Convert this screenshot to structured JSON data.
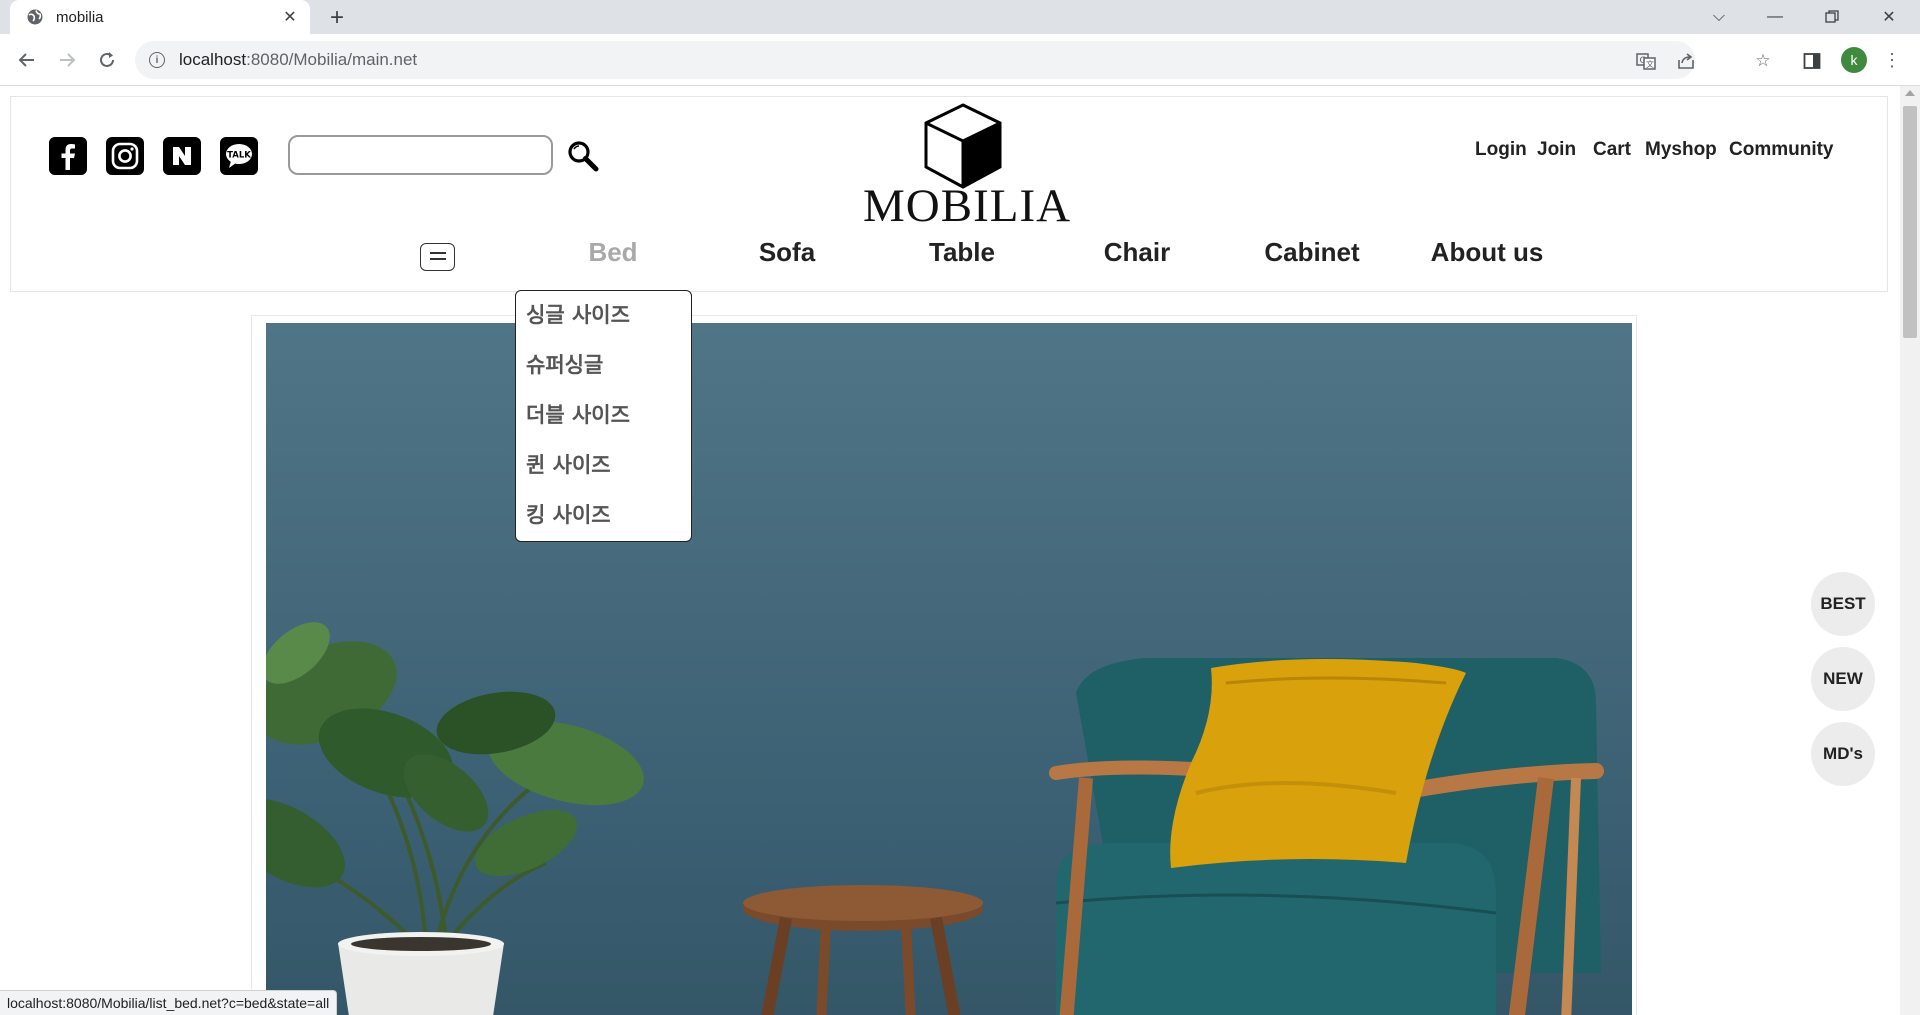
{
  "browser": {
    "tab_title": "mobilia",
    "url_host": "localhost",
    "url_rest": ":8080/Mobilia/main.net",
    "profile_initial": "k",
    "status_url": "localhost:8080/Mobilia/list_bed.net?c=bed&state=all"
  },
  "header": {
    "search_placeholder": "",
    "logo_text": "MOBILIA",
    "util_links": [
      "Login",
      "Join",
      "Cart",
      "Myshop",
      "Community"
    ],
    "nav": [
      "Bed",
      "Sofa",
      "Table",
      "Chair",
      "Cabinet",
      "About us"
    ],
    "active_nav": "Bed",
    "sns": [
      "facebook-icon",
      "instagram-icon",
      "naver-icon",
      "kakaotalk-icon"
    ],
    "sns_labels": {
      "naver": "N",
      "kakao": "TALK"
    }
  },
  "dropdown": {
    "items": [
      "싱글 사이즈",
      "슈퍼싱글",
      "더블 사이즈",
      "퀸 사이즈",
      "킹 사이즈"
    ]
  },
  "floating": [
    "BEST",
    "NEW",
    "MD's"
  ],
  "colors": {
    "hero_wall": "#45697b",
    "pillow": "#d9a10c",
    "chair_fabric": "#1f5f66",
    "wood": "#b87845",
    "profile": "#3f8a3f"
  }
}
